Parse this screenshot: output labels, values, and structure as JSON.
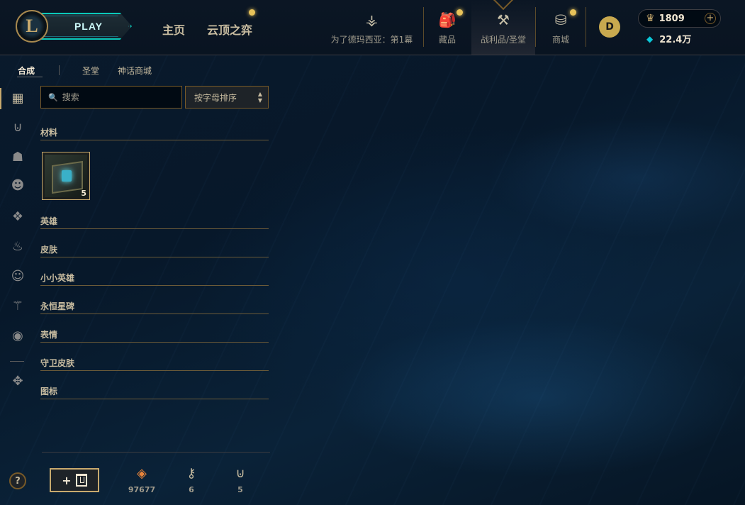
{
  "topbar": {
    "logo_letter": "L",
    "play_label": "PLAY",
    "nav_home": "主页",
    "nav_tft": "云顶之弈",
    "items": [
      {
        "label": "为了德玛西亚：第1幕",
        "icon": "trident-icon"
      },
      {
        "label": "藏品",
        "icon": "collection-icon"
      },
      {
        "label": "战利品/圣堂",
        "icon": "loot-icon"
      },
      {
        "label": "商城",
        "icon": "store-icon"
      }
    ],
    "profile_glyph": "D",
    "rp_value": "1809",
    "rp_plus": "+",
    "be_value": "22.4万"
  },
  "subtabs": {
    "crafting": "合成",
    "sanctum": "圣堂",
    "mythic_shop": "神话商城"
  },
  "search": {
    "placeholder": "搜索",
    "sort_label": "按字母排序"
  },
  "categories": [
    {
      "label": "材料"
    },
    {
      "label": "英雄"
    },
    {
      "label": "皮肤"
    },
    {
      "label": "小小英雄"
    },
    {
      "label": "永恒星碑"
    },
    {
      "label": "表情"
    },
    {
      "label": "守卫皮肤"
    },
    {
      "label": "图标"
    }
  ],
  "materials": {
    "item_count": "5"
  },
  "bottom": {
    "help": "?",
    "add_plus": "+",
    "orange_essence": "97677",
    "keys": "6",
    "chests": "5"
  },
  "colors": {
    "gold": "#c8aa6e",
    "teal": "#0ac8b9",
    "background": "#010a13"
  }
}
